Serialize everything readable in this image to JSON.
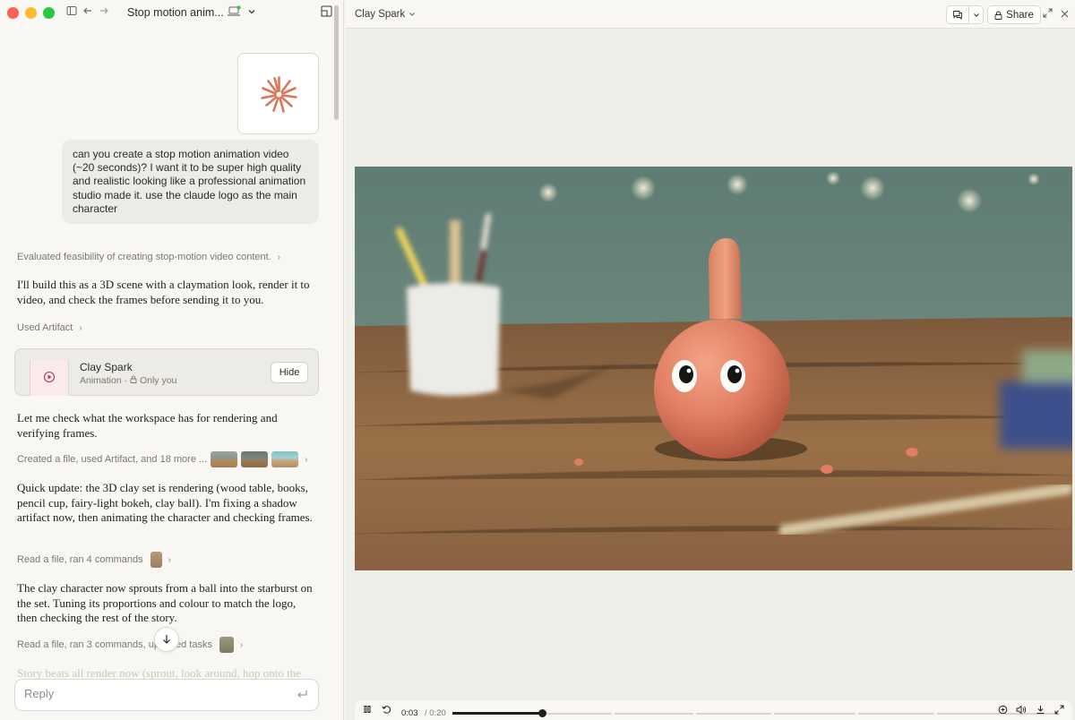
{
  "window": {
    "conversation_title": "Stop motion anim...",
    "icons": [
      "sidebar-toggle-icon",
      "back-arrow-icon",
      "forward-arrow-icon",
      "laptop-icon",
      "chevron-down-icon",
      "panel-icon"
    ]
  },
  "conversation": {
    "user_message": "can you create a stop motion animation video (~20 seconds)? I want it to be super high quality and realistic looking like a professional animation studio made it. use the claude logo as the main character",
    "evaluated": "Evaluated feasibility of creating stop-motion video content.",
    "reply_1": "I'll build this as a 3D scene with a claymation look, render it to video, and check the frames before sending it to you.",
    "used_artifact": "Used Artifact",
    "artifact": {
      "title": "Clay Spark",
      "type": "Animation",
      "visibility": "Only you",
      "hide_label": "Hide"
    },
    "reply_2": "Let me check what the workspace has for rendering and verifying frames.",
    "steps_1": "Created a file, used Artifact, and 18 more ...",
    "reply_3": "Quick update: the 3D clay set is rendering (wood table, books, pencil cup, fairy-light bokeh, clay ball). I'm fixing a shadow artifact now, then animating the character and checking frames.",
    "steps_2": "Read a file, ran 4 commands",
    "reply_4": "The clay character now sprouts from a ball into the starburst on the set. Tuning its proportions and colour to match the logo, then checking the rest of the story.",
    "steps_3_a": "Read a file, ran 3 commands, up",
    "steps_3_b": "ed tasks",
    "reply_5_partial": "Story beats all render now (sprout, look around, hop onto the"
  },
  "reply": {
    "placeholder": "Reply"
  },
  "artifact_panel": {
    "title": "Clay Spark",
    "share_label": "Share",
    "accent_color": "#d97757"
  },
  "player": {
    "current_time": "0:03",
    "total_time": "/ 0:20",
    "progress": 0.15
  }
}
